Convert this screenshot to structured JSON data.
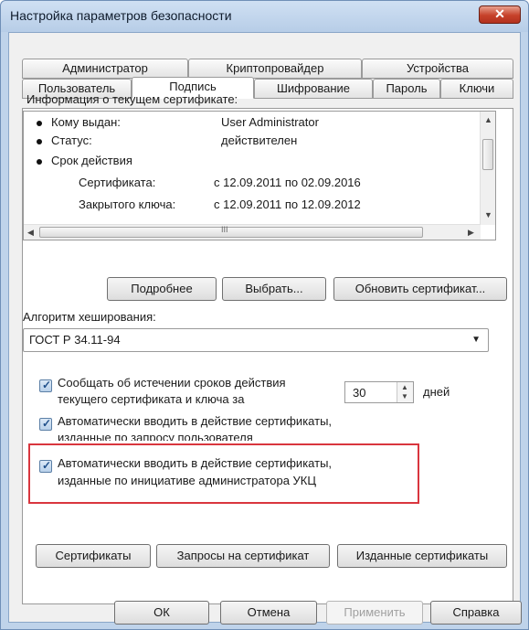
{
  "window": {
    "title": "Настройка параметров безопасности",
    "close_label": "✕"
  },
  "tabs": {
    "row1": [
      "Администратор",
      "Криптопровайдер",
      "Устройства"
    ],
    "row2": [
      "Пользователь",
      "Подпись",
      "Шифрование",
      "Пароль",
      "Ключи"
    ],
    "active": "Подпись"
  },
  "cert_info": {
    "heading": "Информация о текущем сертификате:",
    "rows": [
      {
        "label": "Кому выдан:",
        "value": "User Administrator"
      },
      {
        "label": "Статус:",
        "value": "действителен"
      },
      {
        "label": "Срок действия",
        "value": ""
      },
      {
        "label": "Сертификата:",
        "value": "с 12.09.2011 по 02.09.2016"
      },
      {
        "label": "Закрытого ключа:",
        "value": "с 12.09.2011 по 12.09.2012"
      }
    ],
    "hscroll_thumb_label": "III"
  },
  "cert_buttons": {
    "details": "Подробнее",
    "select": "Выбрать...",
    "update": "Обновить сертификат..."
  },
  "hash": {
    "label": "Алгоритм хеширования:",
    "value": "ГОСТ Р 34.11-94"
  },
  "options": {
    "expiry_line1": "Сообщать об истечении сроков действия",
    "expiry_line2": "текущего сертификата и ключа за",
    "expiry_days": "30",
    "expiry_unit": "дней",
    "auto_user_line1": "Автоматически вводить в действие сертификаты,",
    "auto_user_line2": "изданные по запросу пользователя",
    "auto_admin_line1": "Автоматически вводить в действие сертификаты,",
    "auto_admin_line2": "изданные по инициативе администратора УКЦ",
    "highlight_color": "#d9363e"
  },
  "list_buttons": {
    "certificates": "Сертификаты",
    "requests": "Запросы на сертификат",
    "issued": "Изданные сертификаты"
  },
  "footer": {
    "ok": "ОК",
    "cancel": "Отмена",
    "apply": "Применить",
    "help": "Справка"
  }
}
